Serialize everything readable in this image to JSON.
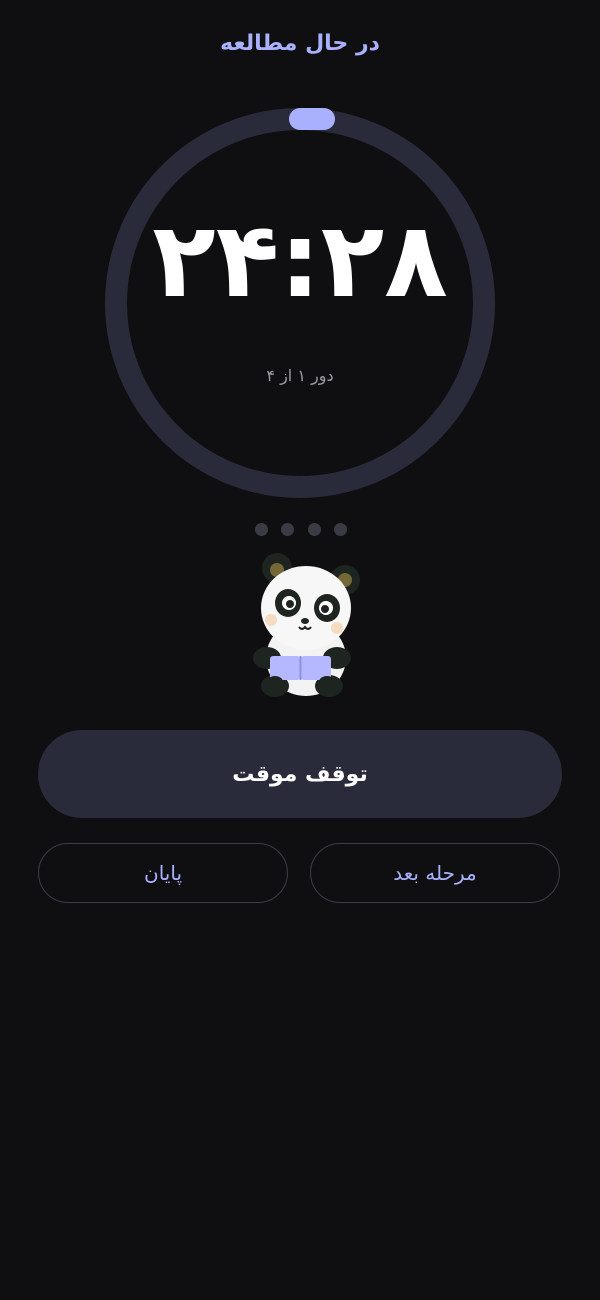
{
  "header": {
    "status": "در حال مطالعه"
  },
  "timer": {
    "time": "۲۴:۲۸",
    "round": "دور ۱ از ۴",
    "progress_fraction": 0.0
  },
  "rounds": {
    "total": 4,
    "current": 1
  },
  "actions": {
    "pause_label": "توقف موقت",
    "end_label": "پایان",
    "next_label": "مرحله بعد"
  },
  "colors": {
    "background": "#0f0f11",
    "accent": "#a9b1ff",
    "ring_track": "#2a2b3a",
    "primary_button": "#2a2b3a"
  },
  "icons": {
    "mascot": "panda-reading-book-icon"
  }
}
